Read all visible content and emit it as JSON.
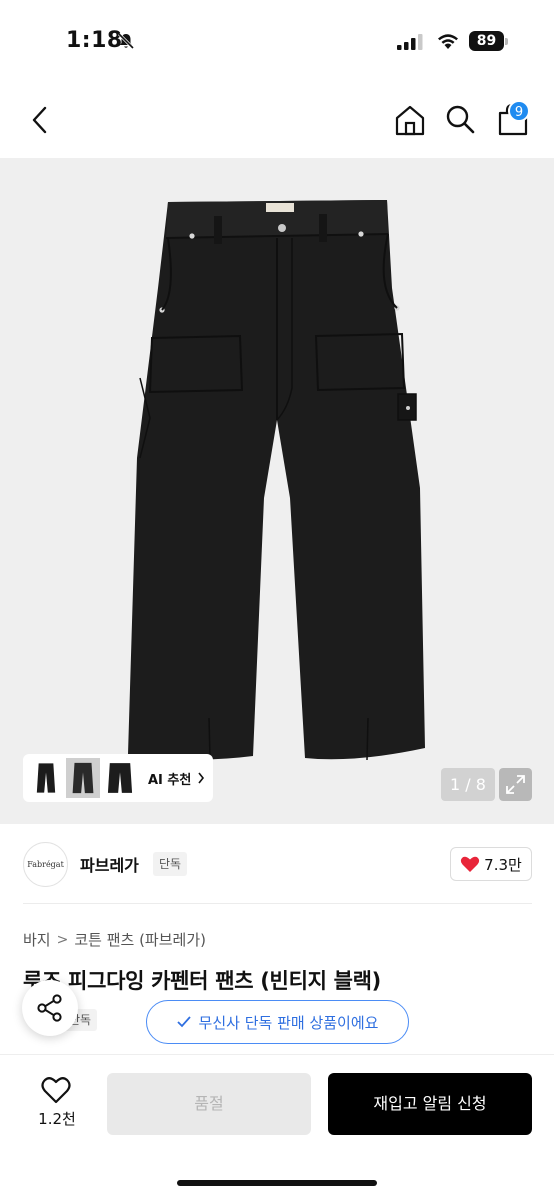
{
  "status_bar": {
    "time": "1:18",
    "battery": "89"
  },
  "nav": {
    "cart_count": "9"
  },
  "gallery": {
    "ai_recommend_label": "AI 추천",
    "page_counter": "1 / 8"
  },
  "brand": {
    "logo_text": "Fabrégat",
    "name": "파브레가",
    "tag": "단독",
    "likes": "7.3만"
  },
  "product": {
    "breadcrumb": [
      "바지",
      "코튼 팬츠 (파브레가)"
    ],
    "title": "루즈 피그다잉 카펜터 팬츠 (빈티지 블랙)",
    "exclusive_tag": "단독",
    "musinsa_notice": "무신사 단독 판매 상품이에요"
  },
  "bottom": {
    "wish_count": "1.2천",
    "soldout_label": "품절",
    "restock_label": "재입고 알림 신청"
  },
  "colors": {
    "accent_blue": "#2f6fe0",
    "badge_blue": "#1f8bf0",
    "heart_red": "#e8253a",
    "product_black": "#1c1c1c"
  }
}
